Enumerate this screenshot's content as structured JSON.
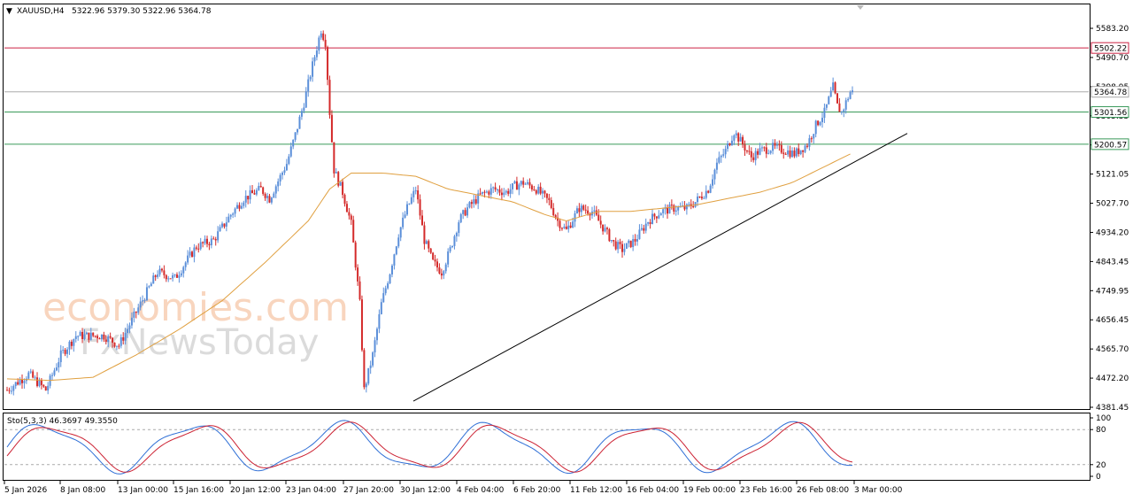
{
  "chart_data": {
    "type": "candlestick",
    "header": {
      "symbol": "XAUUSD,H4",
      "ohlc": "5322.96 5379.30 5322.96 5364.78"
    },
    "y_ticks": [
      "5583.20",
      "5490.70",
      "5398.95",
      "5305.35",
      "5211.80",
      "5121.05",
      "5027.70",
      "4934.20",
      "4843.45",
      "4749.95",
      "4656.45",
      "4565.70",
      "4472.20",
      "4381.45"
    ],
    "ylim": [
      4381.45,
      5583.2
    ],
    "x_ticks": [
      "5 Jan 2026",
      "8 Jan 08:00",
      "13 Jan 00:00",
      "15 Jan 16:00",
      "20 Jan 12:00",
      "23 Jan 04:00",
      "27 Jan 20:00",
      "30 Jan 12:00",
      "4 Feb 04:00",
      "6 Feb 20:00",
      "11 Feb 12:00",
      "16 Feb 04:00",
      "19 Feb 00:00",
      "23 Feb 16:00",
      "26 Feb 08:00",
      "3 Mar 00:00"
    ],
    "levels": [
      {
        "value": 5502.22,
        "label": "5502.22",
        "color": "#cc2244"
      },
      {
        "value": 5364.78,
        "label": "5364.78",
        "color": "#aaaaaa"
      },
      {
        "value": 5301.56,
        "label": "5301.56",
        "color": "#3a9a5a"
      },
      {
        "value": 5200.57,
        "label": "5200.57",
        "color": "#3a9a5a"
      }
    ],
    "trendline": {
      "from": [
        0,
        4395
      ],
      "to": [
        235,
        5290
      ]
    },
    "close_path": [
      [
        0,
        4430
      ],
      [
        10,
        4480
      ],
      [
        18,
        4430
      ],
      [
        25,
        4540
      ],
      [
        32,
        4600
      ],
      [
        45,
        4600
      ],
      [
        52,
        4570
      ],
      [
        62,
        4700
      ],
      [
        70,
        4800
      ],
      [
        78,
        4780
      ],
      [
        88,
        4880
      ],
      [
        96,
        4900
      ],
      [
        104,
        4980
      ],
      [
        110,
        5030
      ],
      [
        118,
        5060
      ],
      [
        122,
        5030
      ],
      [
        130,
        5140
      ],
      [
        134,
        5230
      ],
      [
        138,
        5330
      ],
      [
        141,
        5420
      ],
      [
        146,
        5560
      ],
      [
        148,
        5520
      ],
      [
        150,
        5300
      ],
      [
        152,
        5120
      ],
      [
        156,
        5050
      ],
      [
        160,
        4950
      ],
      [
        164,
        4700
      ],
      [
        166,
        4430
      ],
      [
        170,
        4540
      ],
      [
        174,
        4700
      ],
      [
        178,
        4800
      ],
      [
        182,
        4920
      ],
      [
        186,
        5000
      ],
      [
        190,
        5060
      ],
      [
        194,
        4900
      ],
      [
        198,
        4830
      ],
      [
        202,
        4800
      ],
      [
        206,
        4870
      ],
      [
        210,
        4960
      ],
      [
        214,
        5000
      ],
      [
        220,
        5040
      ],
      [
        226,
        5060
      ],
      [
        232,
        5050
      ],
      [
        236,
        5070
      ],
      [
        240,
        5080
      ],
      [
        246,
        5060
      ],
      [
        252,
        5020
      ],
      [
        256,
        4960
      ],
      [
        260,
        4930
      ],
      [
        266,
        5000
      ],
      [
        272,
        4990
      ],
      [
        276,
        4950
      ],
      [
        282,
        4890
      ],
      [
        286,
        4870
      ],
      [
        292,
        4900
      ],
      [
        298,
        4960
      ],
      [
        304,
        4990
      ],
      [
        310,
        5000
      ],
      [
        316,
        5000
      ],
      [
        320,
        5020
      ],
      [
        326,
        5060
      ],
      [
        330,
        5140
      ],
      [
        334,
        5180
      ],
      [
        338,
        5240
      ],
      [
        342,
        5200
      ],
      [
        346,
        5160
      ],
      [
        350,
        5180
      ],
      [
        356,
        5190
      ],
      [
        362,
        5180
      ],
      [
        366,
        5170
      ],
      [
        372,
        5200
      ],
      [
        376,
        5260
      ],
      [
        380,
        5300
      ],
      [
        384,
        5380
      ],
      [
        386,
        5320
      ],
      [
        388,
        5300
      ],
      [
        392,
        5364
      ]
    ],
    "ma_path": [
      [
        0,
        4465
      ],
      [
        20,
        4460
      ],
      [
        40,
        4470
      ],
      [
        60,
        4540
      ],
      [
        80,
        4620
      ],
      [
        100,
        4710
      ],
      [
        120,
        4830
      ],
      [
        140,
        4960
      ],
      [
        150,
        5060
      ],
      [
        160,
        5110
      ],
      [
        175,
        5110
      ],
      [
        190,
        5100
      ],
      [
        205,
        5060
      ],
      [
        220,
        5040
      ],
      [
        235,
        5020
      ],
      [
        250,
        4980
      ],
      [
        260,
        4960
      ],
      [
        275,
        4990
      ],
      [
        290,
        4990
      ],
      [
        305,
        5000
      ],
      [
        320,
        5010
      ],
      [
        335,
        5030
      ],
      [
        350,
        5050
      ],
      [
        365,
        5080
      ],
      [
        380,
        5130
      ],
      [
        392,
        5170
      ]
    ],
    "stoch": {
      "label": "Sto(5,3,3) 46.3697 49.3550",
      "y_ticks": [
        "100",
        "80",
        "20",
        "0"
      ],
      "levels": [
        80,
        20
      ],
      "ylim": [
        0,
        100
      ]
    },
    "colors": {
      "up": "#5b8fd9",
      "down": "#d42a2a",
      "ma": "#e0a040",
      "main": "#2f6fd6",
      "signal": "#cc2233",
      "trend": "#000000"
    }
  },
  "watermark": {
    "line1": "economies.com",
    "line2": "FxNewsToday"
  }
}
